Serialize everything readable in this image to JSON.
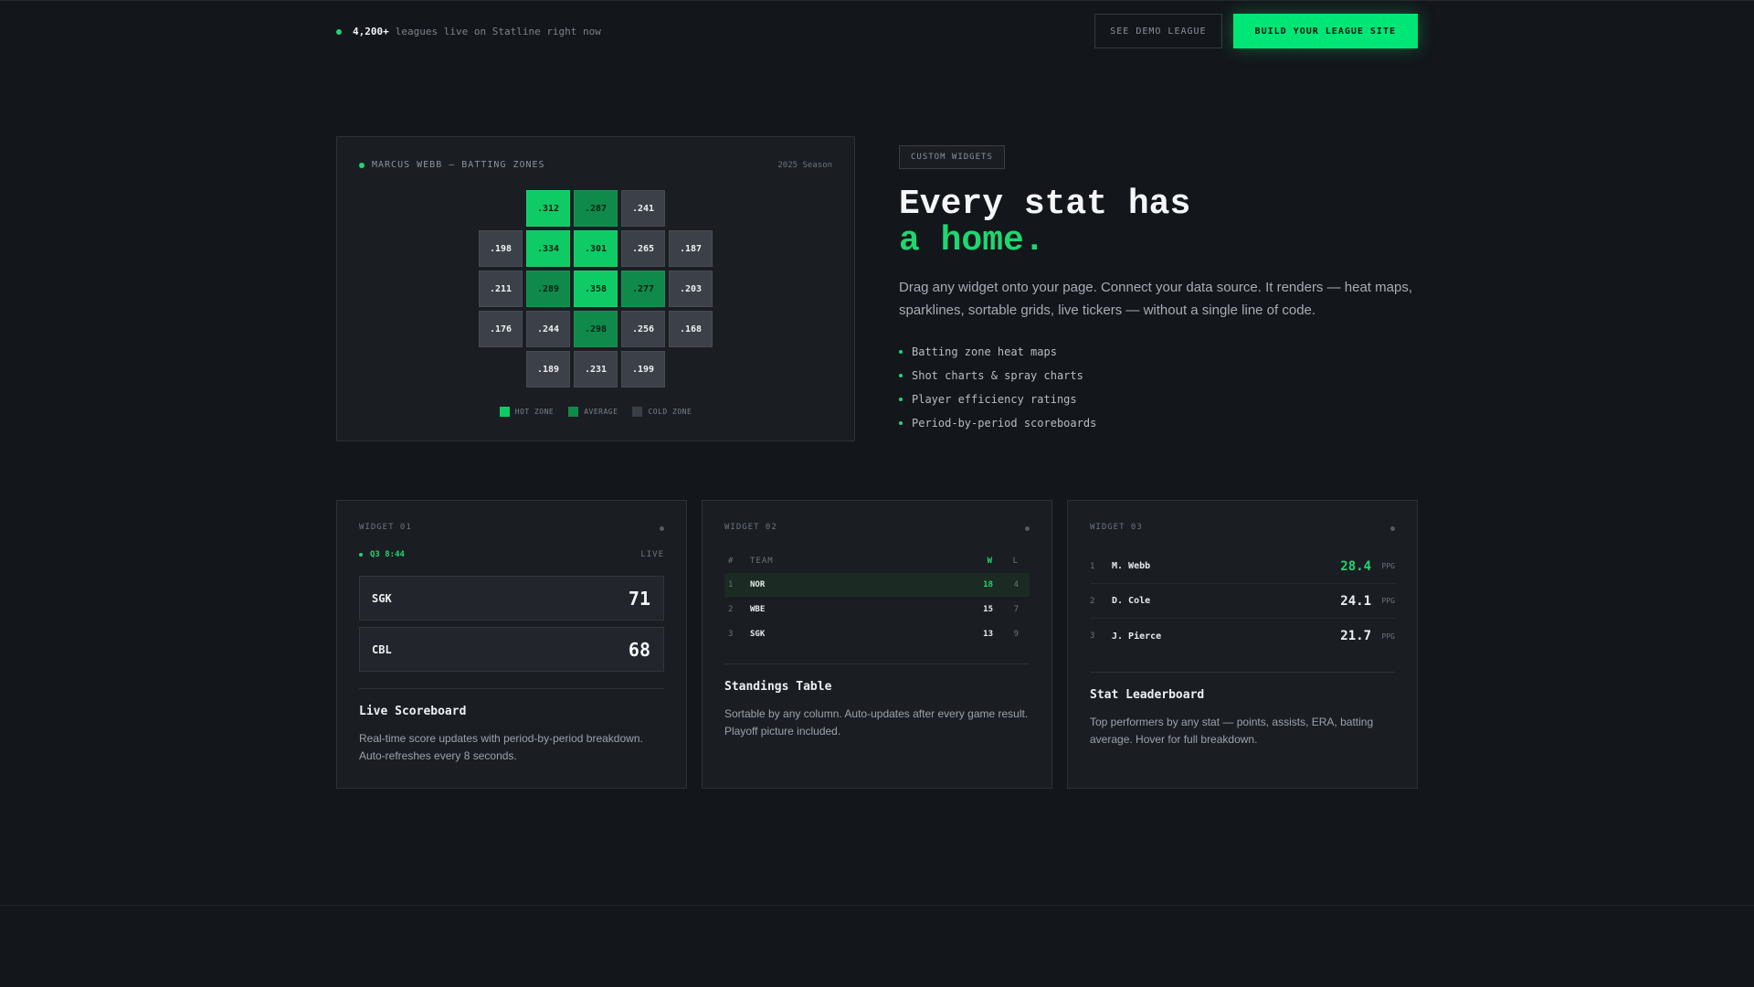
{
  "topbar": {
    "count": "4,200+",
    "note": "leagues live on Statline right now",
    "demo_button": "SEE DEMO LEAGUE",
    "build_button": "BUILD YOUR LEAGUE SITE"
  },
  "heatmap": {
    "title": "MARCUS WEBB — BATTING ZONES",
    "season": "2025 Season",
    "rows": [
      [
        null,
        {
          "v": ".312",
          "z": "hot"
        },
        {
          "v": ".287",
          "z": "avg"
        },
        {
          "v": ".241",
          "z": "cold"
        },
        null
      ],
      [
        {
          "v": ".198",
          "z": "cold"
        },
        {
          "v": ".334",
          "z": "hot"
        },
        {
          "v": ".301",
          "z": "hot"
        },
        {
          "v": ".265",
          "z": "cold"
        },
        {
          "v": ".187",
          "z": "cold"
        }
      ],
      [
        {
          "v": ".211",
          "z": "cold"
        },
        {
          "v": ".289",
          "z": "avg"
        },
        {
          "v": ".358",
          "z": "hot"
        },
        {
          "v": ".277",
          "z": "avg"
        },
        {
          "v": ".203",
          "z": "cold"
        }
      ],
      [
        {
          "v": ".176",
          "z": "cold"
        },
        {
          "v": ".244",
          "z": "cold"
        },
        {
          "v": ".298",
          "z": "avg"
        },
        {
          "v": ".256",
          "z": "cold"
        },
        {
          "v": ".168",
          "z": "cold"
        }
      ],
      [
        null,
        {
          "v": ".189",
          "z": "cold"
        },
        {
          "v": ".231",
          "z": "cold"
        },
        {
          "v": ".199",
          "z": "cold"
        },
        null
      ]
    ],
    "legend": {
      "hot": "HOT ZONE",
      "avg": "AVERAGE",
      "cold": "COLD ZONE"
    },
    "colors": {
      "hot": "#0fcb66",
      "avg": "#0f8a4b",
      "cold": "#3c4048"
    }
  },
  "hero": {
    "tag": "CUSTOM WIDGETS",
    "headline_line1": "Every stat has",
    "headline_line2": "a home.",
    "lede": "Drag any widget onto your page. Connect your data source. It renders — heat maps, sparklines, sortable grids, live tickers — without a single line of code.",
    "bullets": [
      "Batting zone heat maps",
      "Shot charts & spray charts",
      "Player efficiency ratings",
      "Period-by-period scoreboards"
    ]
  },
  "widgets": {
    "scoreboard": {
      "label": "WIDGET 01",
      "period": "Q3 8:44",
      "status": "LIVE",
      "home_team": "SGK",
      "home_score": "71",
      "away_team": "CBL",
      "away_score": "68",
      "title": "Live Scoreboard",
      "desc": "Real-time score updates with period-by-period breakdown. Auto-refreshes every 8 seconds."
    },
    "standings": {
      "label": "WIDGET 02",
      "headers": {
        "rank": "#",
        "team": "TEAM",
        "w": "W",
        "l": "L"
      },
      "rows": [
        {
          "rank": "1",
          "team": "NOR",
          "w": "18",
          "l": "4"
        },
        {
          "rank": "2",
          "team": "WBE",
          "w": "15",
          "l": "7"
        },
        {
          "rank": "3",
          "team": "SGK",
          "w": "13",
          "l": "9"
        }
      ],
      "title": "Standings Table",
      "desc": "Sortable by any column. Auto-updates after every game result. Playoff picture included."
    },
    "leaderboard": {
      "label": "WIDGET 03",
      "rows": [
        {
          "rank": "1",
          "name": "M. Webb",
          "value": "28.4",
          "unit": "PPG"
        },
        {
          "rank": "2",
          "name": "D. Cole",
          "value": "24.1",
          "unit": "PPG"
        },
        {
          "rank": "3",
          "name": "J. Pierce",
          "value": "21.7",
          "unit": "PPG"
        }
      ],
      "title": "Stat Leaderboard",
      "desc": "Top performers by any stat — points, assists, ERA, batting average. Hover for full breakdown."
    }
  },
  "theme": {
    "accent": "#1fd670",
    "background": "#13161b",
    "panel": "#1a1e23"
  }
}
